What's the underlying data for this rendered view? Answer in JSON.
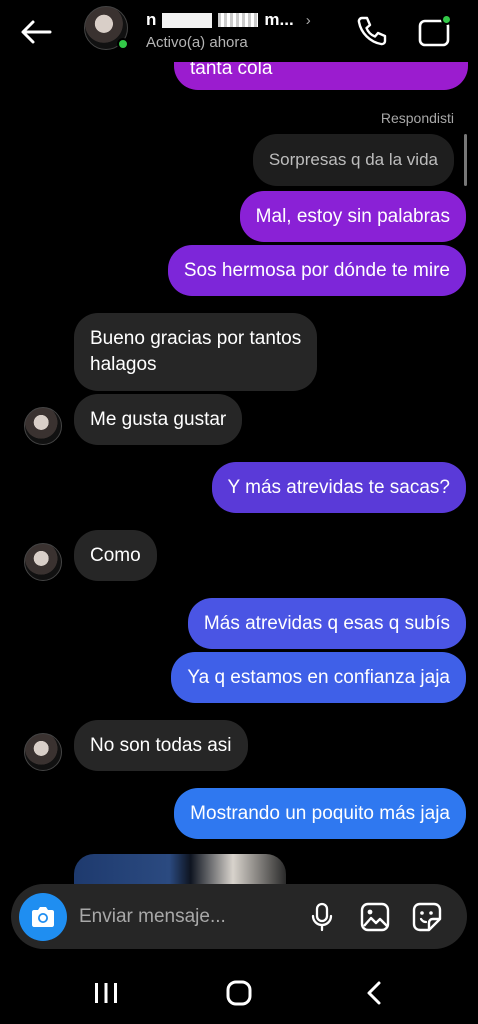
{
  "header": {
    "name_visible": "n",
    "name_partial": "m...",
    "status": "Activo(a) ahora",
    "icons": [
      "arrow-left",
      "phone",
      "video-camera"
    ]
  },
  "conversation": {
    "cut_top_message": "tanta cola",
    "reply_label": "Respondisti",
    "reply_preview": "Sorpresas q da la vida",
    "messages": [
      {
        "sender": "me",
        "text": "Mal, estoy sin palabras"
      },
      {
        "sender": "me",
        "text": "Sos hermosa por dónde te mire"
      },
      {
        "sender": "them",
        "text_line1": "Bueno gracias por tantos",
        "text_line2": "halagos"
      },
      {
        "sender": "them",
        "text": "Me gusta gustar"
      },
      {
        "sender": "me",
        "text": "Y más atrevidas te sacas?"
      },
      {
        "sender": "them",
        "text": "Como"
      },
      {
        "sender": "me",
        "text": "Más atrevidas q esas q subís"
      },
      {
        "sender": "me",
        "text": "Ya q estamos en confianza jaja"
      },
      {
        "sender": "them",
        "text": "No son todas asi"
      },
      {
        "sender": "me",
        "text": "Mostrando un poquito más jaja"
      }
    ],
    "bubble_colors": [
      "#9b1ccf",
      "#8a21d6",
      "#7d26d9",
      "#5a3ad8",
      "#4a55e4",
      "#3f60e8",
      "#2f78f0"
    ]
  },
  "composer": {
    "placeholder": "Enviar mensaje...",
    "icons": [
      "camera",
      "microphone",
      "gallery",
      "sticker"
    ],
    "accent": "#1f8ef1"
  },
  "navbar": {
    "icons": [
      "recent-apps",
      "home",
      "back"
    ]
  }
}
